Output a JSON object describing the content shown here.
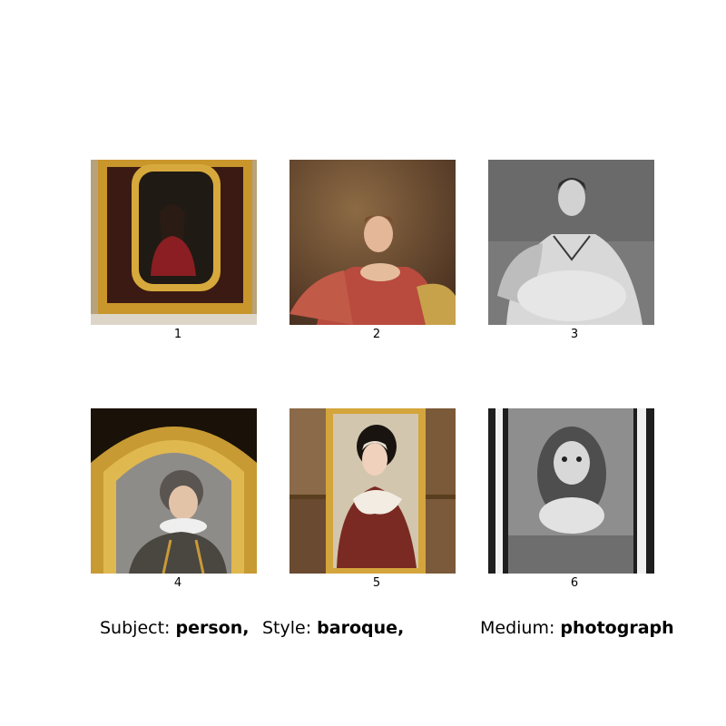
{
  "grid": {
    "images": [
      {
        "label": "1",
        "description_icon": "portrait-in-gilded-frame"
      },
      {
        "label": "2",
        "description_icon": "woman-in-red-dress-portrait"
      },
      {
        "label": "3",
        "description_icon": "grayscale-woman-portrait"
      },
      {
        "label": "4",
        "description_icon": "man-with-ruff-in-arched-frame"
      },
      {
        "label": "5",
        "description_icon": "girl-portrait-in-gallery-frame"
      },
      {
        "label": "6",
        "description_icon": "grayscale-child-photograph"
      }
    ]
  },
  "footer": {
    "subject_label": "Subject:",
    "subject_value": "person,",
    "style_label": "Style:",
    "style_value": "baroque,",
    "medium_label": "Medium:",
    "medium_value": "photograph"
  }
}
